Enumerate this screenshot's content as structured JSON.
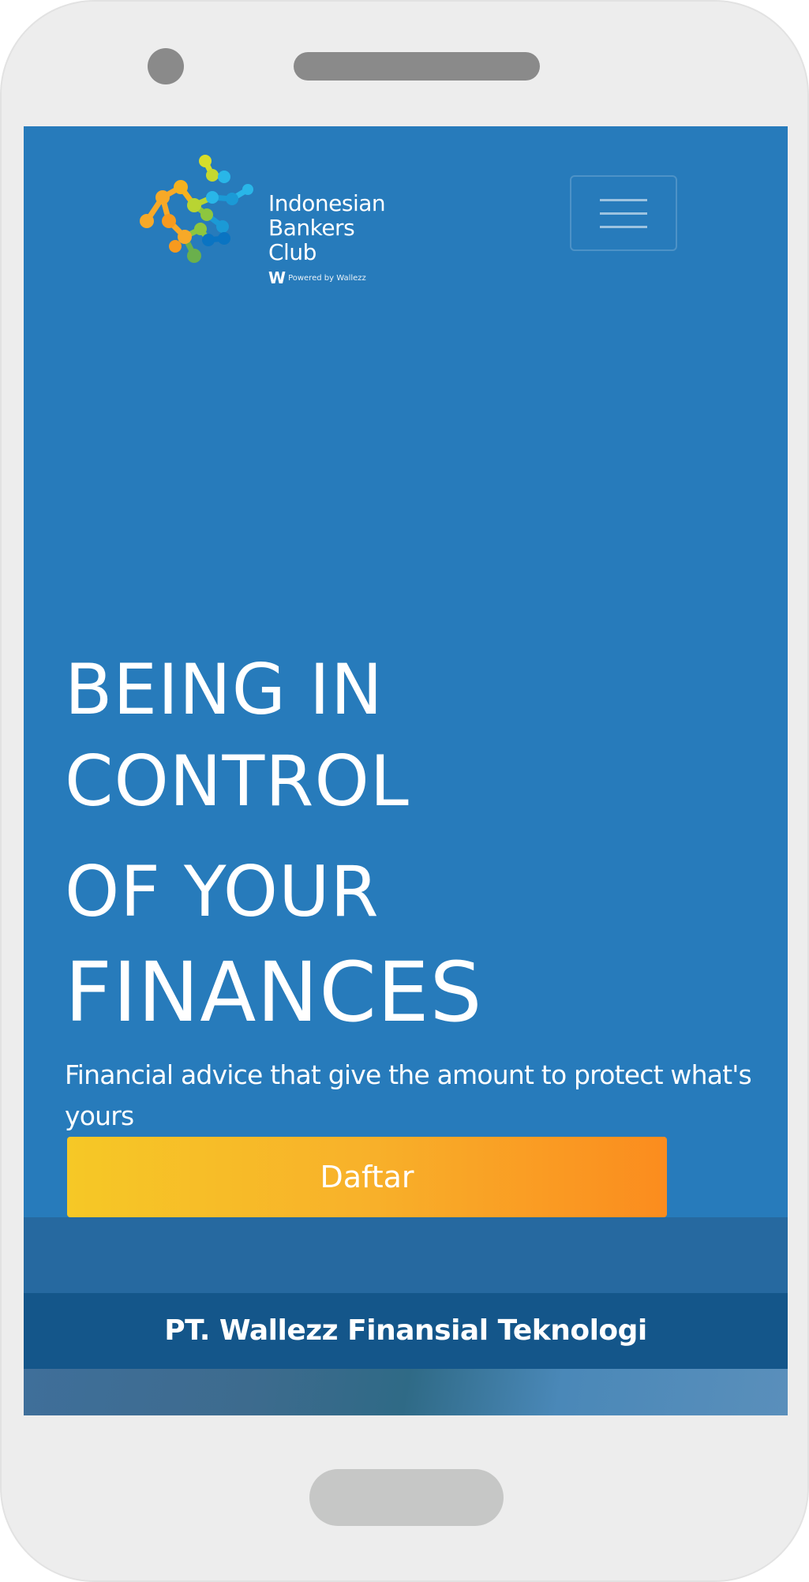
{
  "brand": {
    "name_lines": [
      "Indonesian",
      "Bankers",
      "Club"
    ],
    "powered_mark": "W",
    "powered_text": "Powered by Wallezz"
  },
  "hero": {
    "lines": [
      "BEING IN",
      "CONTROL",
      "OF YOUR",
      "FINANCES"
    ],
    "subtitle": "Financial advice that give the amount to protect what's yours",
    "cta_label": "Daftar"
  },
  "footer": {
    "company": "PT. Wallezz Finansial Teknologi"
  },
  "icons": {
    "menu": "hamburger-icon",
    "logo": "molecule-logo"
  },
  "colors": {
    "background": "#277bbb",
    "cta_start": "#f6c826",
    "cta_end": "#fb8c1e",
    "footer_band": "#14568a"
  }
}
